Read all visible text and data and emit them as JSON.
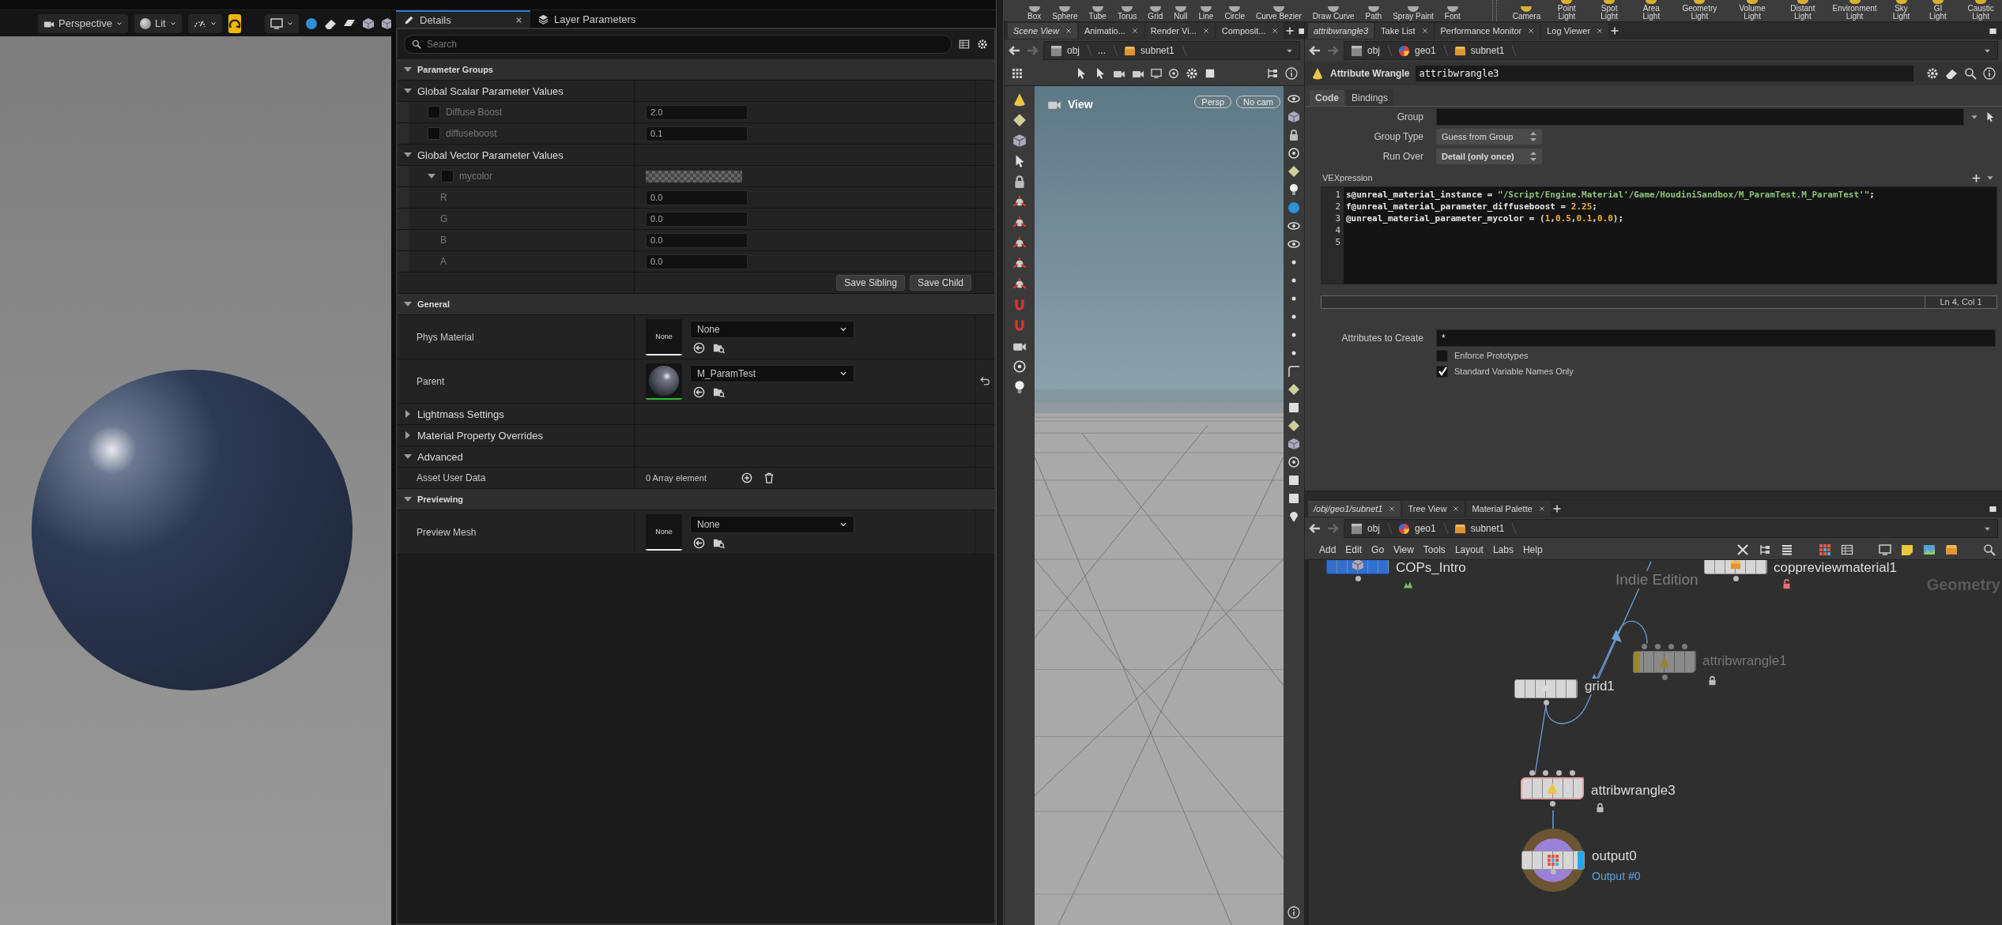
{
  "ue_viewport": {
    "toolbar": [
      {
        "kind": "camera",
        "label": "Perspective"
      },
      {
        "kind": "lit",
        "label": "Lit"
      }
    ]
  },
  "details": {
    "tabs": [
      {
        "label": "Details",
        "selected": true
      },
      {
        "label": "Layer Parameters",
        "selected": false
      }
    ],
    "search": {
      "placeholder": "Search"
    },
    "rows": [
      {
        "kind": "category",
        "label": "Parameter Groups",
        "expanded": true
      },
      {
        "kind": "group",
        "label": "Global Scalar Parameter Values",
        "expanded": true
      },
      {
        "kind": "scalar",
        "label": "Diffuse Boost",
        "value": "2.0",
        "checked": false
      },
      {
        "kind": "scalar",
        "label": "diffuseboost",
        "value": "0.1",
        "checked": false
      },
      {
        "kind": "group",
        "label": "Global Vector Parameter Values",
        "expanded": true
      },
      {
        "kind": "vector",
        "label": "mycolor",
        "checked": false,
        "expanded": true
      },
      {
        "kind": "channel",
        "label": "R",
        "value": "0.0"
      },
      {
        "kind": "channel",
        "label": "G",
        "value": "0.0"
      },
      {
        "kind": "channel",
        "label": "B",
        "value": "0.0"
      },
      {
        "kind": "channel",
        "label": "A",
        "value": "0.0"
      },
      {
        "kind": "buttons",
        "buttons": [
          "Save Sibling",
          "Save Child"
        ]
      },
      {
        "kind": "category",
        "label": "General",
        "expanded": true
      },
      {
        "kind": "asset",
        "label": "Phys Material",
        "thumbnail": "None",
        "value": "None",
        "reset": false
      },
      {
        "kind": "asset",
        "label": "Parent",
        "value": "M_ParamTest",
        "reset": true
      },
      {
        "kind": "group",
        "label": "Lightmass Settings",
        "expanded": false
      },
      {
        "kind": "group",
        "label": "Material Property Overrides",
        "expanded": false
      },
      {
        "kind": "group",
        "label": "Advanced",
        "expanded": true
      },
      {
        "kind": "array",
        "label": "Asset User Data",
        "value": "0 Array element"
      },
      {
        "kind": "category",
        "label": "Previewing",
        "expanded": true
      },
      {
        "kind": "asset",
        "label": "Preview Mesh",
        "thumbnail": "None",
        "value": "None",
        "reset": false
      }
    ]
  },
  "houdini_shelf": {
    "tools": [
      "Box",
      "Sphere",
      "Tube",
      "Torus",
      "Grid",
      "Null",
      "Line",
      "Circle",
      "Curve Bezier",
      "Draw Curve",
      "Path",
      "Spray Paint",
      "Font"
    ],
    "lights": [
      "Camera",
      "Point Light",
      "Spot Light",
      "Area Light",
      "Geometry Light",
      "Volume Light",
      "Distant Light",
      "Environment Light",
      "Sky Light",
      "GI Light",
      "Caustic Light"
    ]
  },
  "scene_pane": {
    "tabs": [
      {
        "label": "Scene View",
        "selected": true
      },
      {
        "label": "Animatio...",
        "selected": false
      },
      {
        "label": "Render Vi...",
        "selected": false
      },
      {
        "label": "Composit...",
        "selected": false
      }
    ],
    "path": [
      "obj",
      "...",
      "subnet1"
    ],
    "viewport": {
      "title": "View",
      "camera_buttons": [
        "Persp",
        "No cam"
      ]
    }
  },
  "params_pane": {
    "tabs": [
      {
        "label": "attribwrangle3",
        "selected": true
      },
      {
        "label": "Take List",
        "selected": false
      },
      {
        "label": "Performance Monitor",
        "selected": false
      },
      {
        "label": "Log Viewer",
        "selected": false
      }
    ],
    "path": [
      "obj",
      "geo1",
      "subnet1"
    ],
    "node_type": "Attribute Wrangle",
    "node_name": "attribwrangle3",
    "param_tabs": [
      {
        "label": "Code",
        "selected": true
      },
      {
        "label": "Bindings",
        "selected": false
      }
    ],
    "fields": [
      {
        "kind": "text",
        "label": "Group"
      },
      {
        "kind": "menu",
        "label": "Group Type",
        "value": "Guess from Group"
      },
      {
        "kind": "menu",
        "label": "Run Over",
        "value": "Detail (only once)"
      }
    ],
    "vex": {
      "label": "VEXpression",
      "line_numbers": [
        "1",
        "2",
        "3",
        "4",
        "5"
      ],
      "lines": [
        [
          {
            "kind": "plain",
            "text": "s@unreal_material_instance = "
          },
          {
            "kind": "string",
            "text": "\"/Script/Engine.Material'/Game/HoudiniSandbox/M_ParamTest.M_ParamTest'\""
          },
          {
            "kind": "plain",
            "text": ";"
          }
        ],
        [
          {
            "kind": "plain",
            "text": "f@unreal_material_parameter_diffuseboost = "
          },
          {
            "kind": "number",
            "text": "2.25"
          },
          {
            "kind": "plain",
            "text": ";"
          }
        ],
        [
          {
            "kind": "plain",
            "text": "@unreal_material_parameter_mycolor = ("
          },
          {
            "kind": "number",
            "text": "1"
          },
          {
            "kind": "plain",
            "text": ","
          },
          {
            "kind": "number",
            "text": "0.5"
          },
          {
            "kind": "plain",
            "text": ","
          },
          {
            "kind": "number",
            "text": "0.1"
          },
          {
            "kind": "plain",
            "text": ","
          },
          {
            "kind": "number",
            "text": "0.0"
          },
          {
            "kind": "plain",
            "text": ");"
          }
        ]
      ],
      "status": "Ln 4, Col 1"
    },
    "attributes_to_create": {
      "label": "Attributes to Create",
      "value": "*"
    },
    "checkboxes": [
      {
        "label": "Enforce Prototypes",
        "checked": false
      },
      {
        "label": "Standard Variable Names Only",
        "checked": true
      }
    ]
  },
  "network_pane": {
    "tabs": [
      {
        "label": "/obj/geo1/subnet1",
        "selected": true
      },
      {
        "label": "Tree View",
        "selected": false
      },
      {
        "label": "Material Palette",
        "selected": false
      }
    ],
    "path": [
      "obj",
      "geo1",
      "subnet1"
    ],
    "menu": [
      "Add",
      "Edit",
      "Go",
      "View",
      "Tools",
      "Layout",
      "Labs",
      "Help"
    ],
    "edition_label": "Indie Edition",
    "context_label": "Geometry",
    "nodes": [
      {
        "name": "COPs_Intro",
        "kind": "cop",
        "bypassed": false,
        "selected": false,
        "display": false
      },
      {
        "name": "coppreviewmaterial1",
        "kind": "material",
        "bypassed": false,
        "selected": false,
        "display": false
      },
      {
        "name": "grid1",
        "kind": "grid",
        "bypassed": false,
        "selected": false,
        "display": false
      },
      {
        "name": "attribwrangle1",
        "kind": "wrangle",
        "bypassed": true,
        "selected": false,
        "display": false
      },
      {
        "name": "attribwrangle3",
        "kind": "wrangle",
        "bypassed": false,
        "selected": true,
        "display": false
      },
      {
        "name": "output0",
        "kind": "output",
        "bypassed": false,
        "selected": false,
        "display": true,
        "comment": "Output #0"
      }
    ]
  }
}
